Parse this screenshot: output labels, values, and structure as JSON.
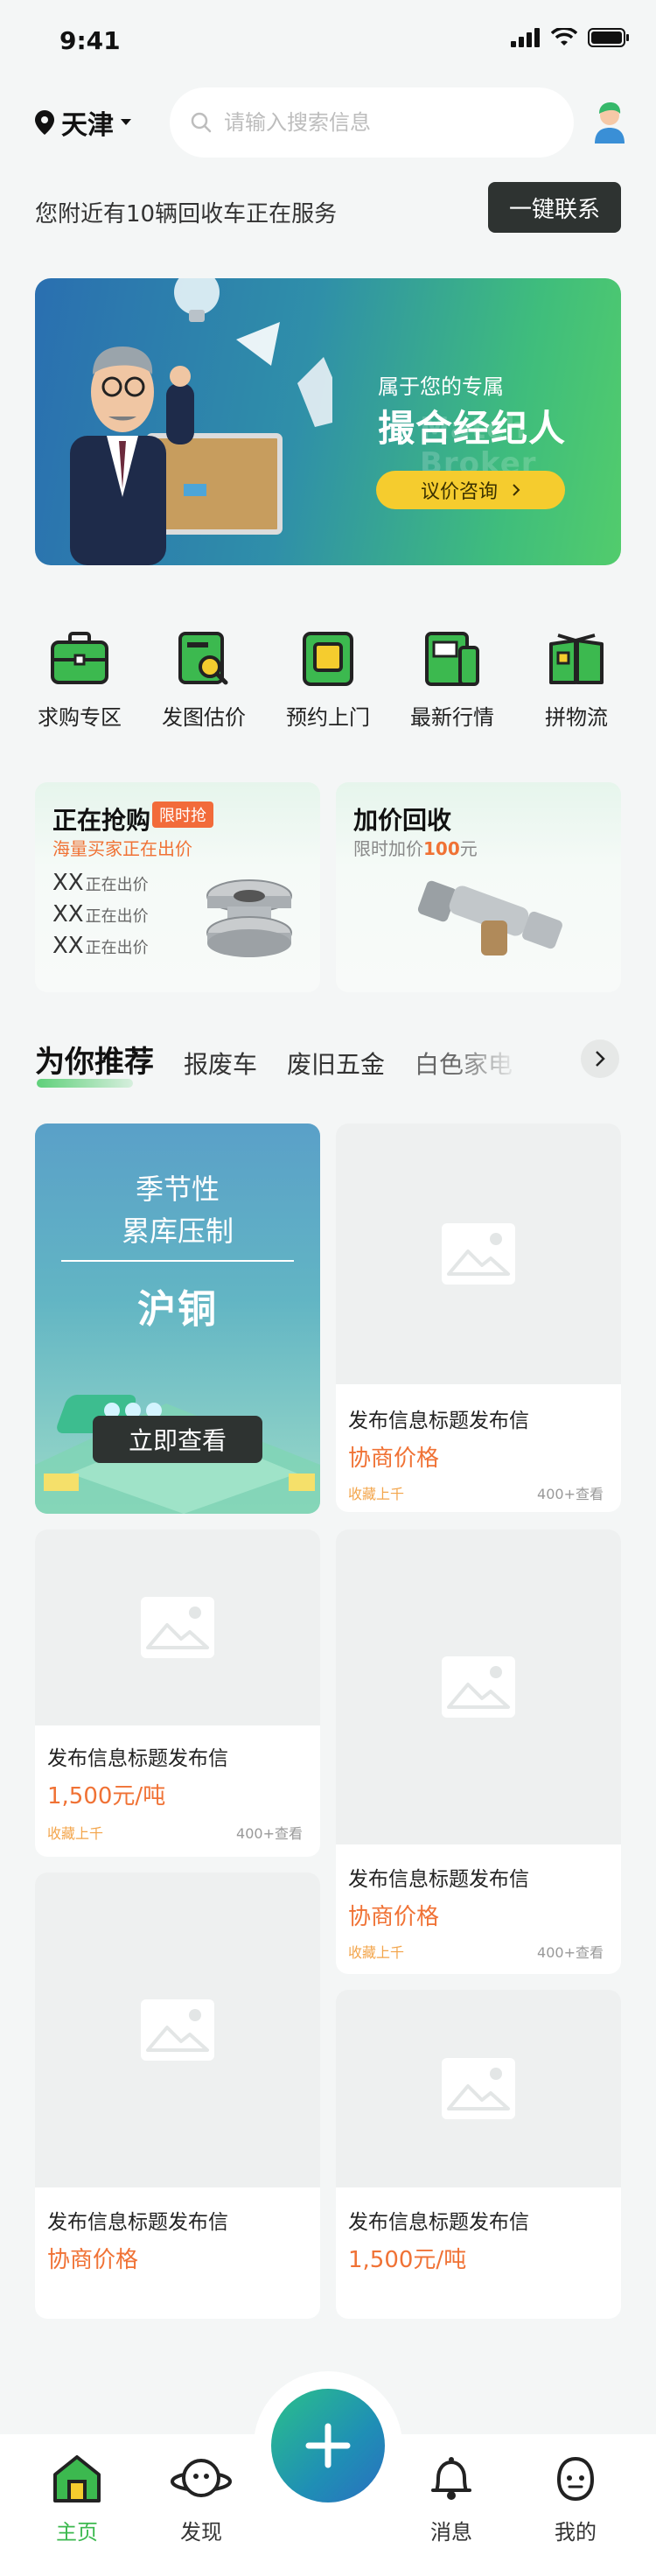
{
  "status": {
    "time": "9:41"
  },
  "header": {
    "city": "天津",
    "search_placeholder": "请输入搜索信息"
  },
  "notice": {
    "text": "您附近有10辆回收车正在服务",
    "button": "一键联系"
  },
  "banner": {
    "subtitle": "属于您的专属",
    "title": "撮合经纪人",
    "watermark": "Match Broker",
    "button": "议价咨询"
  },
  "categories": [
    {
      "label": "求购专区",
      "icon": "briefcase-icon"
    },
    {
      "label": "发图估价",
      "icon": "photo-search-icon"
    },
    {
      "label": "预约上门",
      "icon": "calendar-icon"
    },
    {
      "label": "最新行情",
      "icon": "news-icon"
    },
    {
      "label": "拼物流",
      "icon": "book-icon"
    }
  ],
  "promo_left": {
    "title": "正在抢购",
    "tag": "限时抢",
    "subtitle": "海量买家正在出价",
    "rows": [
      {
        "name": "XX",
        "status": "正在出价"
      },
      {
        "name": "XX",
        "status": "正在出价"
      },
      {
        "name": "XX",
        "status": "正在出价"
      }
    ]
  },
  "promo_right": {
    "title": "加价回收",
    "subtitle_prefix": "限时加价",
    "subtitle_amount": "100",
    "subtitle_suffix": "元"
  },
  "tabs": [
    "为你推荐",
    "报废车",
    "废旧五金",
    "白色家电"
  ],
  "feature": {
    "line1": "季节性",
    "line2": "累库压制",
    "big": "沪铜",
    "button": "立即查看"
  },
  "cards": [
    {
      "title": "发布信息标题发布信",
      "price": "协商价格",
      "meta_left": "收藏上千",
      "meta_right": "400+查看"
    },
    {
      "title": "发布信息标题发布信",
      "price": "1,500元/吨",
      "meta_left": "收藏上千",
      "meta_right": "400+查看"
    },
    {
      "title": "发布信息标题发布信",
      "price": "协商价格",
      "meta_left": "收藏上千",
      "meta_right": "400+查看"
    },
    {
      "title": "发布信息标题发布信",
      "price": "协商价格"
    },
    {
      "title": "发布信息标题发布信",
      "price": "1,500元/吨"
    }
  ],
  "nav": [
    {
      "label": "主页",
      "icon": "home-icon",
      "active": true
    },
    {
      "label": "发现",
      "icon": "planet-icon"
    },
    {
      "label": "消息",
      "icon": "bell-icon"
    },
    {
      "label": "我的",
      "icon": "profile-icon"
    }
  ],
  "colors": {
    "accent": "#3cb94f",
    "price": "#f07235",
    "dark_button": "#2e3331",
    "banner_button": "#f5cc2e"
  }
}
